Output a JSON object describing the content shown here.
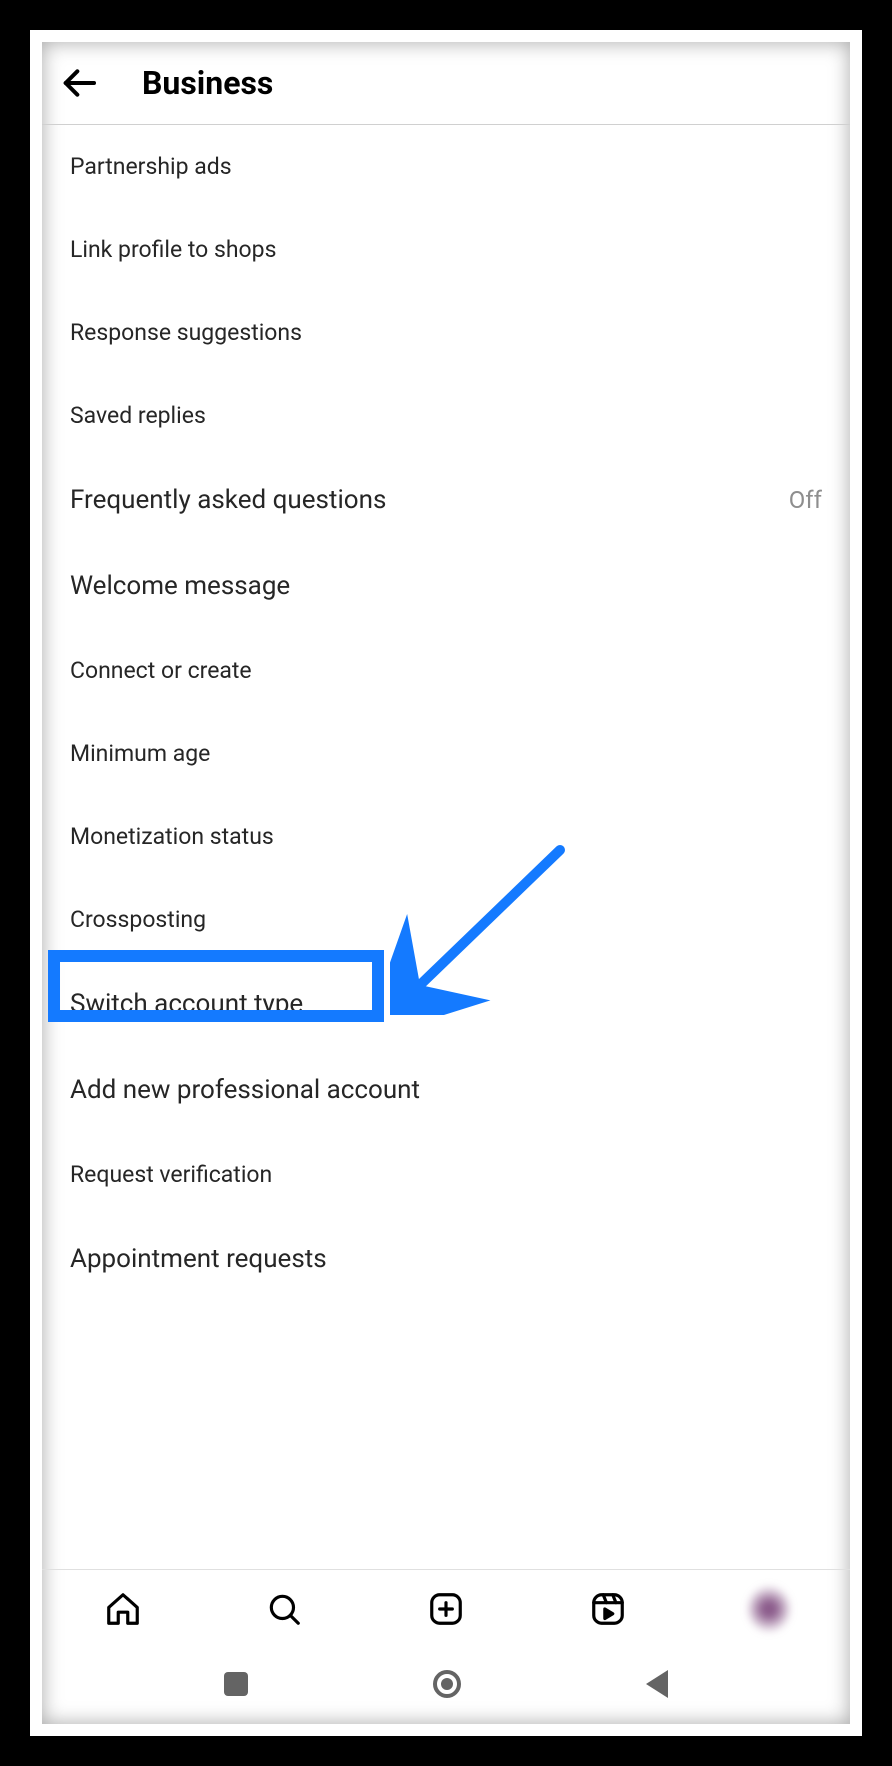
{
  "header": {
    "title": "Business"
  },
  "menu": {
    "items": [
      {
        "label": "Partnership ads",
        "status": null
      },
      {
        "label": "Link profile to shops",
        "status": null
      },
      {
        "label": "Response suggestions",
        "status": null
      },
      {
        "label": "Saved replies",
        "status": null
      },
      {
        "label": "Frequently asked questions",
        "status": "Off"
      },
      {
        "label": "Welcome message",
        "status": null
      },
      {
        "label": "Connect or create",
        "status": null
      },
      {
        "label": "Minimum age",
        "status": null
      },
      {
        "label": "Monetization status",
        "status": null
      },
      {
        "label": "Crossposting",
        "status": null
      },
      {
        "label": "Switch account type",
        "status": null
      },
      {
        "label": "Add new professional account",
        "status": null
      },
      {
        "label": "Request verification",
        "status": null
      },
      {
        "label": "Appointment requests",
        "status": null
      }
    ]
  },
  "annotation": {
    "highlighted_item_index": 10,
    "highlight_color": "#147aff"
  }
}
